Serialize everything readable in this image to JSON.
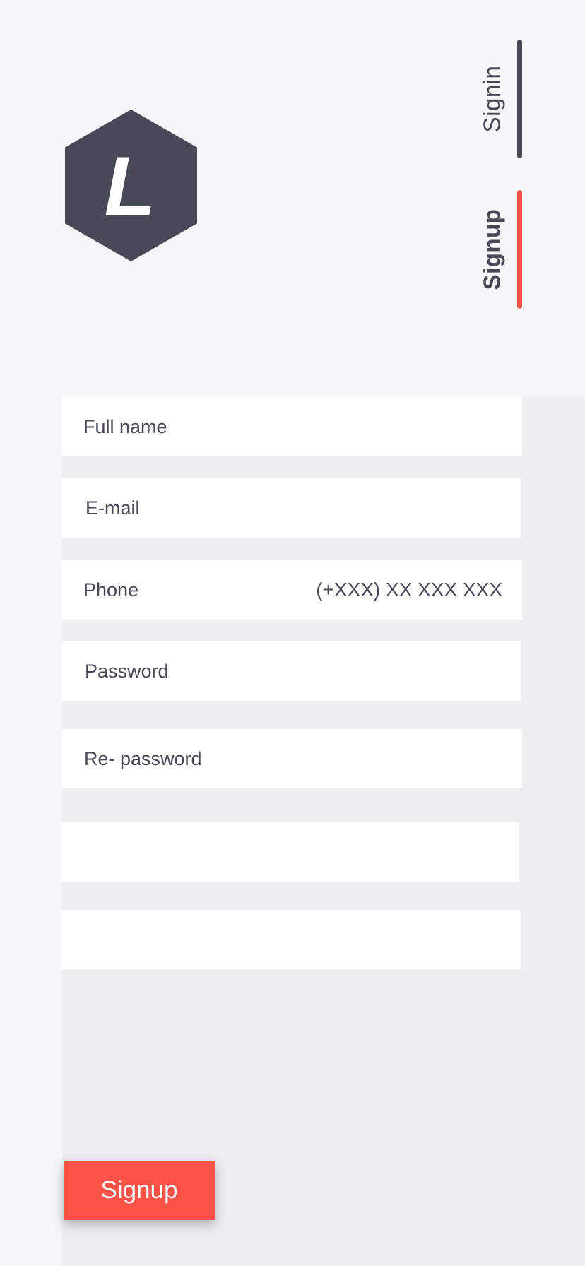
{
  "brand": {
    "logo_letter": "L",
    "logo_icon": "hexagon-logo",
    "logo_color": "#474a56"
  },
  "tabs": [
    {
      "label": "Signin",
      "active": false,
      "indicator_color": "#474a56"
    },
    {
      "label": "Signup",
      "active": true,
      "indicator_color": "#fb5247"
    }
  ],
  "form": {
    "fields": [
      {
        "label": "Full name",
        "placeholder": ""
      },
      {
        "label": "E-mail",
        "placeholder": ""
      },
      {
        "label": "Phone",
        "placeholder": "(+XXX) XX XXX XXX"
      },
      {
        "label": "Password",
        "placeholder": ""
      },
      {
        "label": "Re- password",
        "placeholder": ""
      },
      {
        "label": "",
        "placeholder": ""
      },
      {
        "label": "",
        "placeholder": ""
      }
    ],
    "submit_label": "Signup"
  },
  "colors": {
    "accent": "#fb5247",
    "text": "#474a56",
    "background": "#f5f6f8",
    "panel": "#edeef0",
    "field": "#ffffff"
  }
}
